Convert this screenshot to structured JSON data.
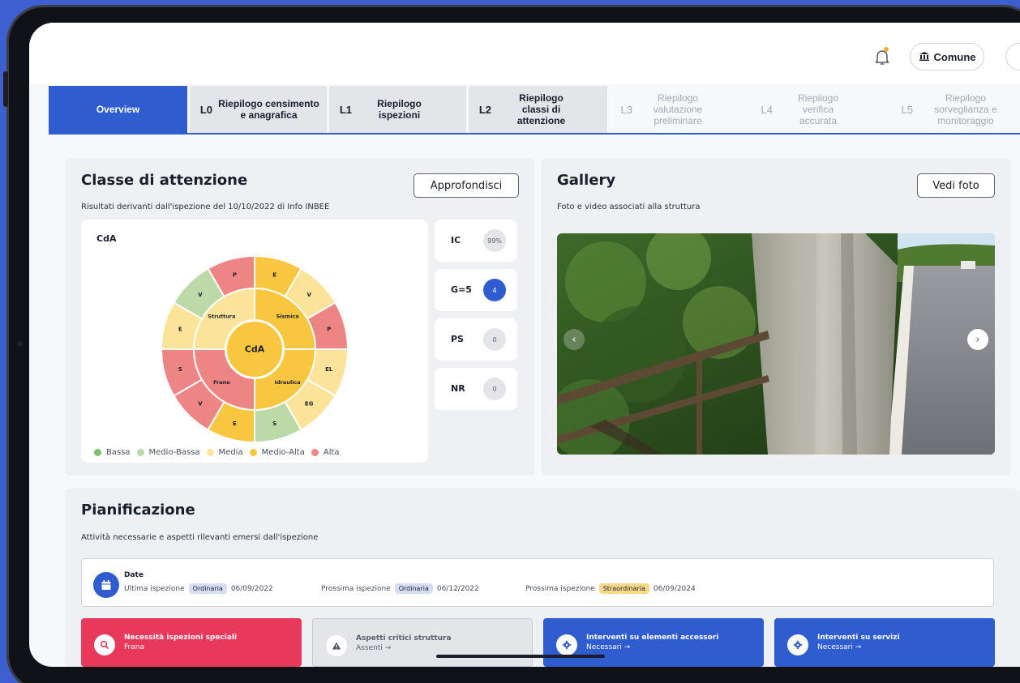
{
  "header": {
    "comune_label": "Comune"
  },
  "tabs": [
    {
      "code": "",
      "label": "Overview",
      "state": "active"
    },
    {
      "code": "L0",
      "label": "Riepilogo censimento e anagrafica",
      "state": "normal"
    },
    {
      "code": "L1",
      "label": "Riepilogo ispezioni",
      "state": "normal"
    },
    {
      "code": "L2",
      "label": "Riepilogo classi di attenzione",
      "state": "normal"
    },
    {
      "code": "L3",
      "label": "Riepilogo valutazione preliminare",
      "state": "disabled"
    },
    {
      "code": "L4",
      "label": "Riepilogo verifica accurata",
      "state": "disabled"
    },
    {
      "code": "L5",
      "label": "Riepilogo sorveglianza e monitoraggio",
      "state": "disabled"
    }
  ],
  "classe": {
    "title": "Classe di attenzione",
    "subtitle": "Risultati derivanti dall'ispezione del 10/10/2022 di Info INBEE",
    "button": "Approfondisci",
    "chart_label": "CdA",
    "center_label": "CdA",
    "legend": [
      {
        "label": "Bassa",
        "color": "#7dbf6a"
      },
      {
        "label": "Medio-Bassa",
        "color": "#bcd9a8"
      },
      {
        "label": "Media",
        "color": "#fbe39a"
      },
      {
        "label": "Medio-Alta",
        "color": "#f8c63f"
      },
      {
        "label": "Alta",
        "color": "#ee8585"
      }
    ],
    "kpis": [
      {
        "key": "IC",
        "value": "99%",
        "highlight": false
      },
      {
        "key": "G=5",
        "value": "4",
        "highlight": true
      },
      {
        "key": "PS",
        "value": "0",
        "highlight": false
      },
      {
        "key": "NR",
        "value": "0",
        "highlight": false
      }
    ]
  },
  "chart_data": {
    "type": "sunburst",
    "center": {
      "label": "CdA",
      "level": "Medio-Alta"
    },
    "inner": [
      {
        "label": "Sismica",
        "level": "Medio-Alta"
      },
      {
        "label": "Idraulica",
        "level": "Medio-Alta"
      },
      {
        "label": "Frane",
        "level": "Alta"
      },
      {
        "label": "Struttura",
        "level": "Media"
      }
    ],
    "outer": [
      {
        "label": "E",
        "parent": "Sismica",
        "level": "Medio-Alta"
      },
      {
        "label": "V",
        "parent": "Sismica",
        "level": "Media"
      },
      {
        "label": "P",
        "parent": "Sismica",
        "level": "Alta"
      },
      {
        "label": "EL",
        "parent": "Idraulica",
        "level": "Media"
      },
      {
        "label": "EG",
        "parent": "Idraulica",
        "level": "Media"
      },
      {
        "label": "S",
        "parent": "Idraulica",
        "level": "Medio-Bassa"
      },
      {
        "label": "E",
        "parent": "Frane",
        "level": "Medio-Alta"
      },
      {
        "label": "V",
        "parent": "Frane",
        "level": "Alta"
      },
      {
        "label": "S",
        "parent": "Frane",
        "level": "Alta"
      },
      {
        "label": "E",
        "parent": "Struttura",
        "level": "Media"
      },
      {
        "label": "V",
        "parent": "Struttura",
        "level": "Medio-Bassa"
      },
      {
        "label": "P",
        "parent": "Struttura",
        "level": "Alta"
      }
    ]
  },
  "gallery": {
    "title": "Gallery",
    "subtitle": "Foto e video associati alla struttura",
    "button": "Vedi foto"
  },
  "pianificazione": {
    "title": "Pianificazione",
    "subtitle": "Attività necessarie e aspetti rilevanti emersi dall'ispezione",
    "date_title": "Date",
    "dates": [
      {
        "label": "Ultima ispezione",
        "badge": "Ordinaria",
        "badge_type": "ord",
        "date": "06/09/2022"
      },
      {
        "label": "Prossima ispezione",
        "badge": "Ordinaria",
        "badge_type": "ord",
        "date": "06/12/2022"
      },
      {
        "label": "Prossima ispezione",
        "badge": "Straordinaria",
        "badge_type": "straord",
        "date": "06/09/2024"
      }
    ],
    "actions": [
      {
        "title": "Necessità ispezioni speciali",
        "sub": "Frana",
        "icon": "search-icon",
        "bg": "#e8395a",
        "fg": "#ffffff"
      },
      {
        "title": "Aspetti critici struttura",
        "sub": "Assenti →",
        "icon": "warning-icon",
        "bg": "#e3e5e9",
        "fg": "#5a5f6a"
      },
      {
        "title": "Interventi su elementi accessori",
        "sub": "Necessari →",
        "icon": "gear-icon",
        "bg": "#2f5ccf",
        "fg": "#ffffff"
      },
      {
        "title": "Interventi su servizi",
        "sub": "Necessari →",
        "icon": "gear-icon",
        "bg": "#2f5ccf",
        "fg": "#ffffff"
      }
    ]
  }
}
